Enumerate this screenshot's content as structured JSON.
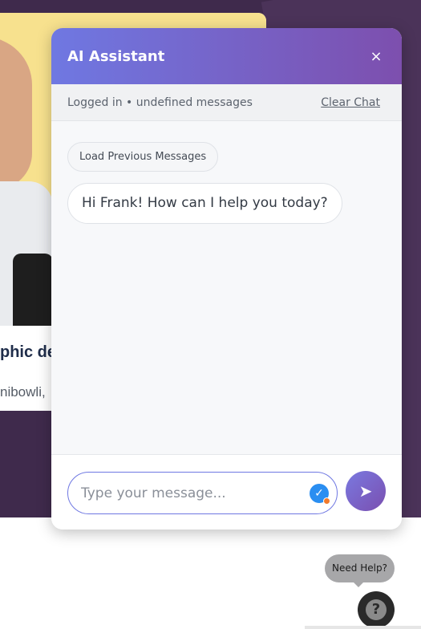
{
  "background": {
    "card_title": "phic de",
    "card_subtitle": "nibowli,"
  },
  "chat": {
    "title": "AI Assistant",
    "close_icon": "×",
    "status_text": "Logged in • undefined messages",
    "clear_label": "Clear Chat",
    "load_previous_label": "Load Previous Messages",
    "messages": [
      {
        "text": "Hi Frank! How can I help you today?"
      }
    ],
    "input_placeholder": "Type your message...",
    "send_icon": "➤",
    "check_icon": "✓"
  },
  "help": {
    "bubble_text": "Need Help?",
    "icon": "?"
  },
  "colors": {
    "header_start": "#6f78e2",
    "header_end": "#7d4fae",
    "page_bg": "#3f2a4c"
  }
}
